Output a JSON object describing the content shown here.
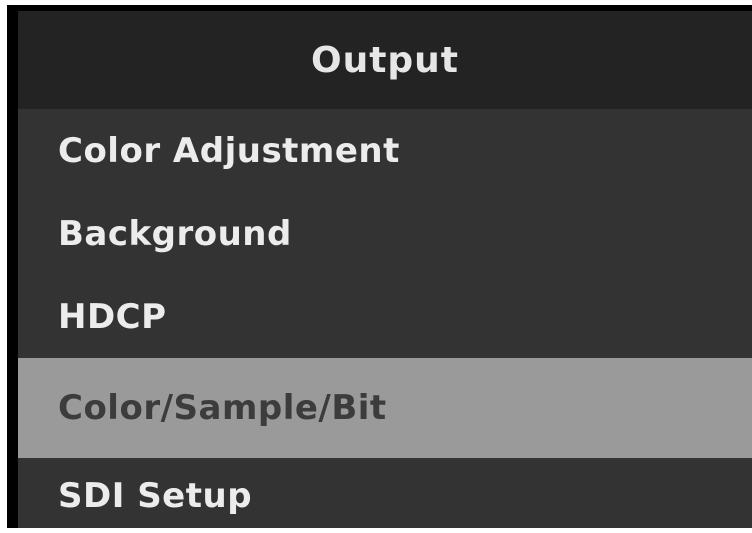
{
  "header": {
    "title": "Output"
  },
  "menu": {
    "selected_index": 3,
    "items": [
      {
        "label": "Color Adjustment"
      },
      {
        "label": "Background"
      },
      {
        "label": "HDCP"
      },
      {
        "label": "Color/Sample/Bit"
      },
      {
        "label": "SDI Setup"
      }
    ]
  },
  "colors": {
    "frame": "#000000",
    "panel": "#333333",
    "header_bg": "#232323",
    "selected_bg": "#9a9a9a",
    "text": "#ececec",
    "selected_text": "#3c3c3c"
  }
}
